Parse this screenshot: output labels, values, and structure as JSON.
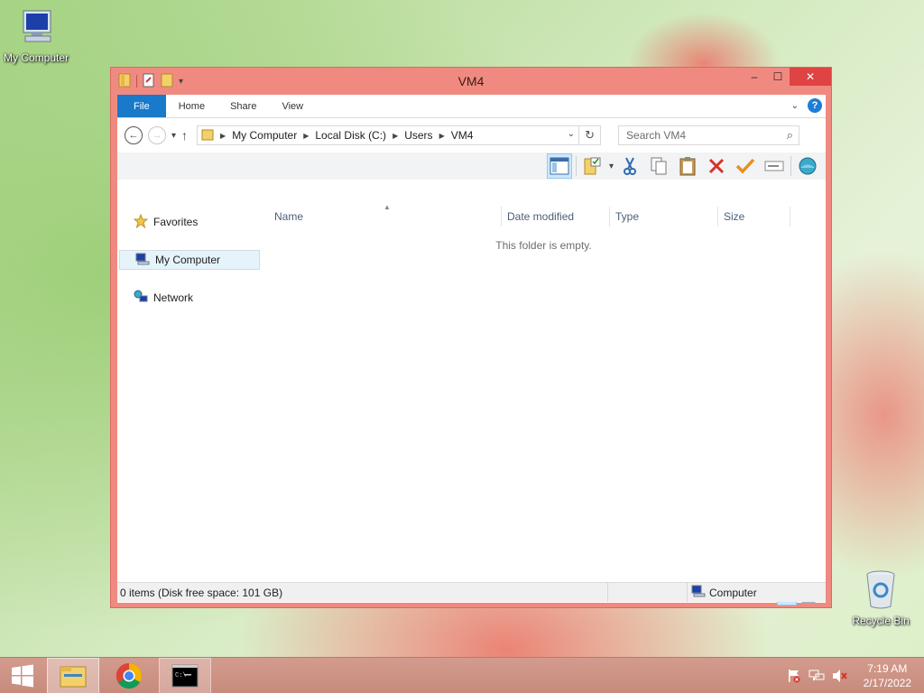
{
  "desktop": {
    "icons": [
      {
        "label": "My Computer",
        "icon": "computer-icon"
      },
      {
        "label": "Recycle Bin",
        "icon": "recycle-bin-icon"
      }
    ]
  },
  "window": {
    "title": "VM4",
    "controls": {
      "minimize": "–",
      "maximize": "☐",
      "close": "✕"
    },
    "ribbon_tabs": [
      "File",
      "Home",
      "Share",
      "View"
    ],
    "address": {
      "breadcrumbs": [
        "My Computer",
        "Local Disk (C:)",
        "Users",
        "VM4"
      ],
      "search_placeholder": "Search VM4"
    },
    "nav_pane": [
      {
        "label": "Favorites",
        "icon": "star-icon"
      },
      {
        "label": "My Computer",
        "icon": "computer-icon",
        "selected": true
      },
      {
        "label": "Network",
        "icon": "network-icon"
      }
    ],
    "columns": [
      "Name",
      "Date modified",
      "Type",
      "Size"
    ],
    "empty_message": "This folder is empty.",
    "item_count": "0 items",
    "status": {
      "left": "0 items (Disk free space: 101 GB)",
      "right": "Computer"
    }
  },
  "taskbar": {
    "apps": [
      "start-icon",
      "file-explorer-icon",
      "chrome-icon",
      "command-prompt-icon"
    ],
    "tray_icons": [
      "action-center-flag-icon",
      "network-tray-icon",
      "volume-muted-icon"
    ],
    "time": "7:19 AM",
    "date": "2/17/2022"
  },
  "colors": {
    "window_frame": "#f08a80",
    "close_button": "#e04343",
    "file_tab": "#1979ca",
    "taskbar": "#cc9383"
  }
}
